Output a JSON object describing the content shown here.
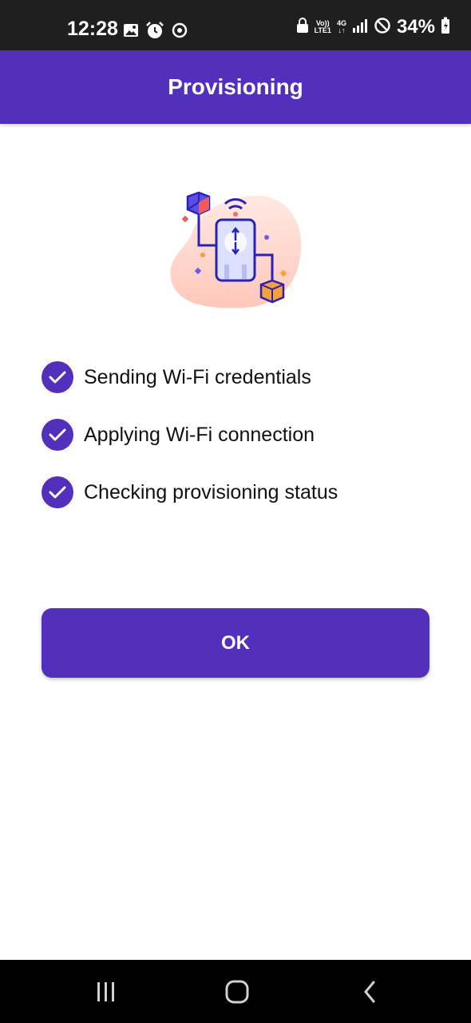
{
  "status_bar": {
    "time": "12:28",
    "left_icons": [
      "gallery-icon",
      "alarm-icon",
      "sync-icon"
    ],
    "network": {
      "volte": "Vo))",
      "lte": "LTE1",
      "gen": "4G"
    },
    "battery": "34%"
  },
  "app_bar": {
    "title": "Provisioning"
  },
  "steps": [
    {
      "label": "Sending Wi-Fi credentials",
      "status": "done"
    },
    {
      "label": "Applying Wi-Fi connection",
      "status": "done"
    },
    {
      "label": "Checking provisioning status",
      "status": "done"
    }
  ],
  "ok_button": {
    "label": "OK"
  },
  "nav_bar": {
    "buttons": [
      "recents-icon",
      "home-icon",
      "back-icon"
    ]
  },
  "colors": {
    "primary": "#5230bb",
    "status_bar": "#1f1f1f",
    "nav_bar": "#000000"
  }
}
